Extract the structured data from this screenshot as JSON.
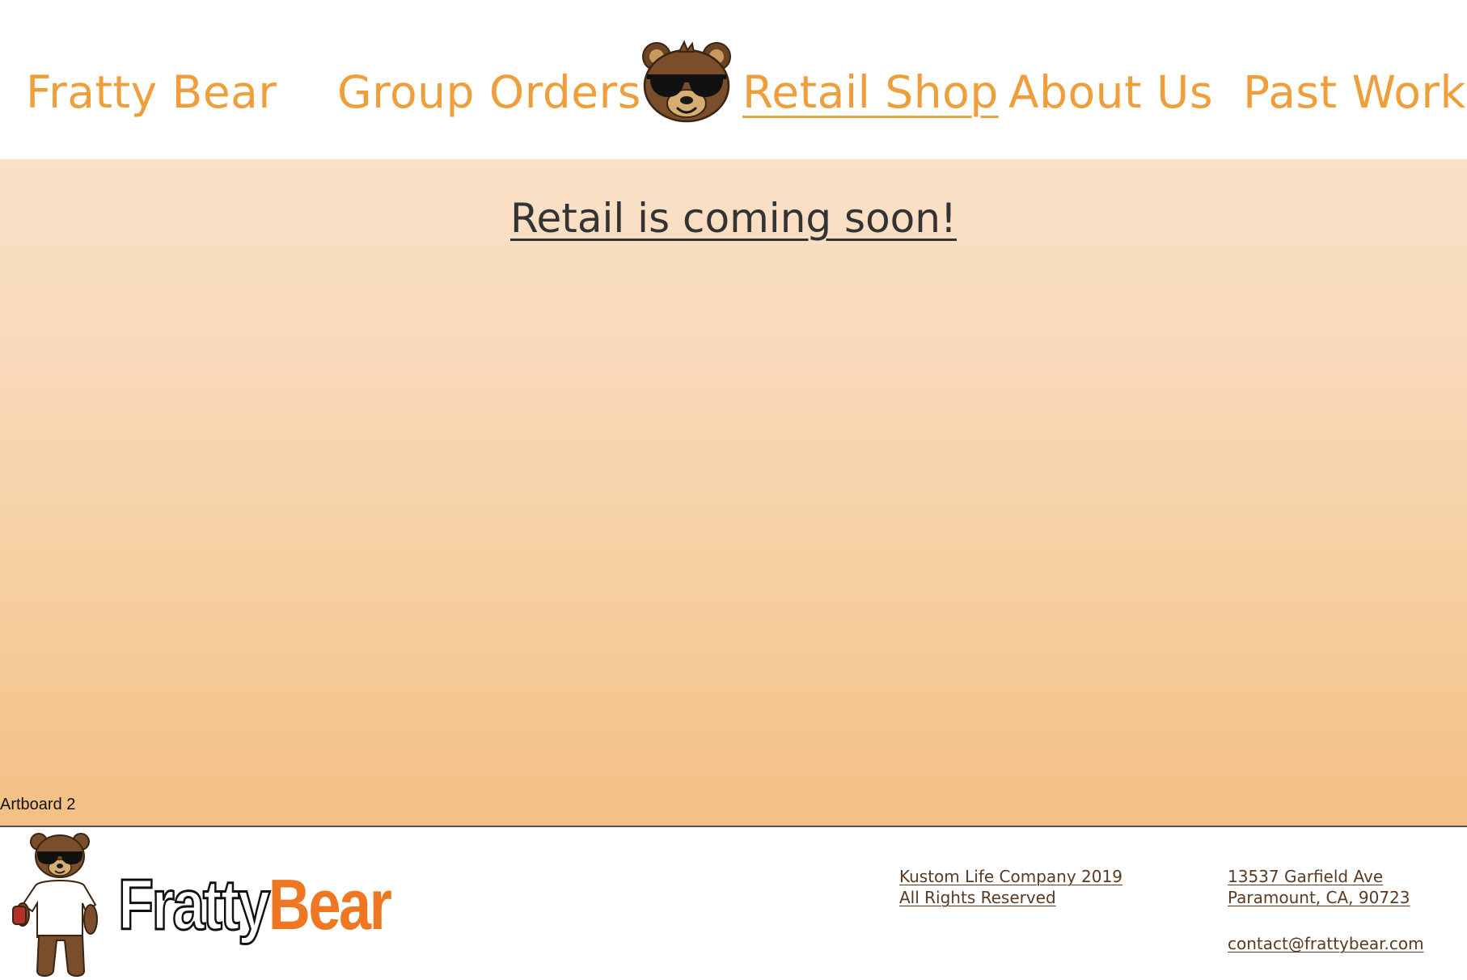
{
  "nav": {
    "brand": "Fratty Bear",
    "group_orders": "Group Orders",
    "logo_icon": "bear-sunglasses-icon",
    "retail_shop": "Retail Shop",
    "about_us": "About Us",
    "past_work": "Past Work",
    "active": "Retail Shop"
  },
  "main": {
    "heading": "Retail is coming soon!",
    "artboard_label": "Artboard 2"
  },
  "footer": {
    "mascot_icon": "bear-mascot-icon",
    "wordmark_part1": "Fratty",
    "wordmark_part2": "Bear",
    "company": "Kustom Life Company 2019",
    "rights": "All Rights Reserved",
    "street": "13537 Garfield Ave",
    "city": "Paramount, CA, 90723",
    "email": "contact@frattybear.com"
  },
  "colors": {
    "nav_text": "#ee9f3c",
    "gradient_top": "#f9e1c6",
    "gradient_bottom": "#f3bf84",
    "heading_text": "#333333",
    "wordmark_bear": "#f07722",
    "footer_text": "#5a3a22"
  }
}
